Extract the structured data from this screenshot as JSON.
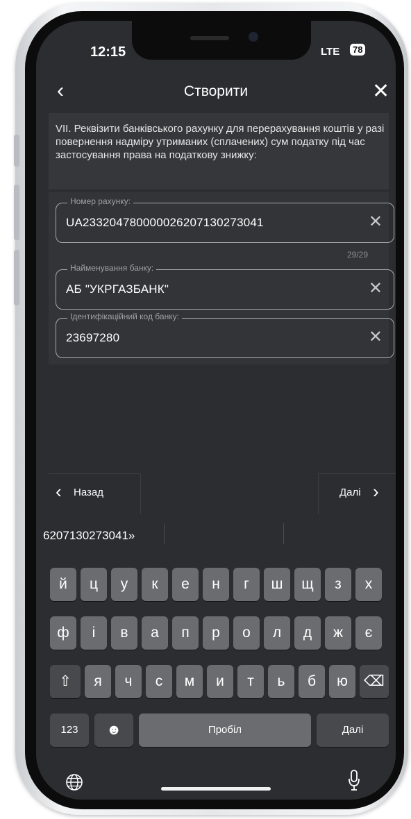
{
  "status_bar": {
    "time": "12:15",
    "network": "LTE",
    "battery": "78"
  },
  "header": {
    "back_icon": "‹",
    "title": "Створити",
    "close_icon": "✕"
  },
  "section": {
    "text": "VII. Реквізити банківського рахунку для перерахування коштів у разі повернення надміру утриманих (сплачених) сум податку під час застосування права на податкову знижку:"
  },
  "fields": [
    {
      "label": "Номер рахунку:",
      "value": "UA233204780000026207130273041",
      "clear": "✕"
    },
    {
      "label": "Найменування банку:",
      "value": "АБ \"УКРГАЗБАНК\"",
      "clear": "✕"
    },
    {
      "label": "Ідентифікаційний код банку:",
      "value": "23697280",
      "clear": "✕"
    }
  ],
  "counter": "29/29",
  "nav": {
    "back_label": "Назад",
    "next_label": "Далі",
    "back_chevron": "‹",
    "next_chevron": "›"
  },
  "keyboard": {
    "suggestion": "6207130273041»",
    "row1": [
      "й",
      "ц",
      "у",
      "к",
      "е",
      "н",
      "г",
      "ш",
      "щ",
      "з",
      "х"
    ],
    "row2": [
      "ф",
      "і",
      "в",
      "а",
      "п",
      "р",
      "о",
      "л",
      "д",
      "ж",
      "є"
    ],
    "row3": [
      "я",
      "ч",
      "с",
      "м",
      "и",
      "т",
      "ь",
      "б",
      "ю"
    ],
    "shift_icon": "⇧",
    "delete_icon": "⌫",
    "numbers_label": "123",
    "emoji_icon": "☻",
    "space_label": "Пробіл",
    "return_label": "Далі"
  }
}
